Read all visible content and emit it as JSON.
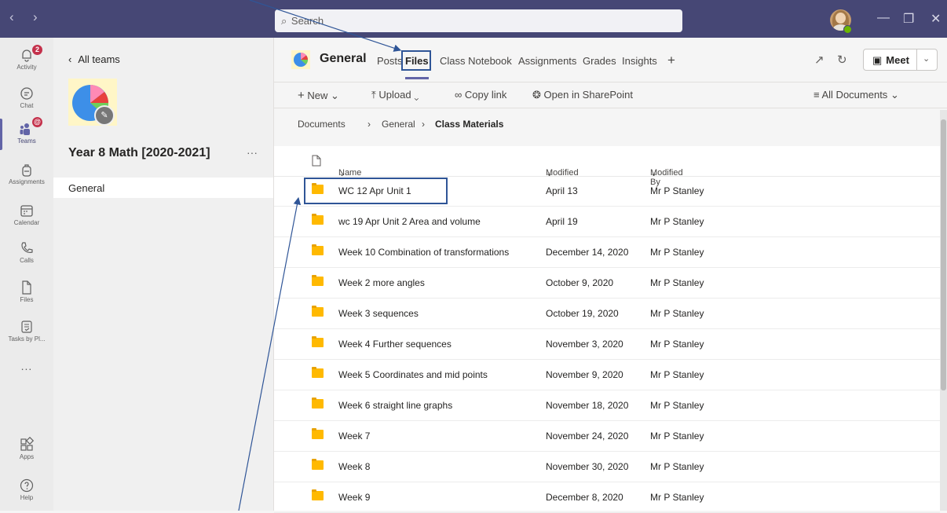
{
  "topbar": {
    "search_placeholder": "Search",
    "back_icon": "chevron-left-icon",
    "forward_icon": "chevron-right-icon",
    "minimize_icon": "minimize-icon",
    "restore_icon": "restore-icon",
    "close_icon": "close-icon"
  },
  "rail": {
    "items": [
      {
        "label": "Activity",
        "icon": "bell-icon",
        "badge": "2"
      },
      {
        "label": "Chat",
        "icon": "chat-icon"
      },
      {
        "label": "Teams",
        "icon": "teams-icon",
        "badge": "@"
      },
      {
        "label": "Assignments",
        "icon": "backpack-icon"
      },
      {
        "label": "Calendar",
        "icon": "calendar-icon"
      },
      {
        "label": "Calls",
        "icon": "phone-icon"
      },
      {
        "label": "Files",
        "icon": "file-icon"
      },
      {
        "label": "Tasks by Pl...",
        "icon": "tasks-icon"
      },
      {
        "label": "...",
        "icon": "more-icon"
      },
      {
        "label": "Apps",
        "icon": "apps-icon"
      },
      {
        "label": "Help",
        "icon": "help-icon"
      }
    ]
  },
  "teampanel": {
    "back_label": "All teams",
    "team_name": "Year 8 Math [2020-2021]",
    "more": "···",
    "channels": [
      "General"
    ]
  },
  "channel_header": {
    "name": "General",
    "tabs": [
      "Posts",
      "Files",
      "Class Notebook",
      "Assignments",
      "Grades",
      "Insights"
    ],
    "active_tab": "Files",
    "add_tab": "+",
    "meet_label": "Meet"
  },
  "toolbar": {
    "new_label": "New",
    "upload_label": "Upload",
    "copy_link_label": "Copy link",
    "open_sharepoint_label": "Open in SharePoint",
    "view_label": "All Documents"
  },
  "breadcrumb": {
    "items": [
      "Documents",
      "General",
      "Class Materials"
    ]
  },
  "table": {
    "headers": {
      "name": "Name",
      "modified": "Modified",
      "modified_by": "Modified By"
    },
    "rows": [
      {
        "name": "WC 12 Apr Unit 1",
        "modified": "April 13",
        "by": "Mr P Stanley"
      },
      {
        "name": "wc 19 Apr Unit 2 Area and volume",
        "modified": "April 19",
        "by": "Mr P Stanley"
      },
      {
        "name": "Week 10 Combination of transformations",
        "modified": "December 14, 2020",
        "by": "Mr P Stanley"
      },
      {
        "name": "Week 2 more angles",
        "modified": "October 9, 2020",
        "by": "Mr P Stanley"
      },
      {
        "name": "Week 3 sequences",
        "modified": "October 19, 2020",
        "by": "Mr P Stanley"
      },
      {
        "name": "Week 4 Further sequences",
        "modified": "November 3, 2020",
        "by": "Mr P Stanley"
      },
      {
        "name": "Week 5 Coordinates and mid points",
        "modified": "November 9, 2020",
        "by": "Mr P Stanley"
      },
      {
        "name": "Week 6 straight line graphs",
        "modified": "November 18, 2020",
        "by": "Mr P Stanley"
      },
      {
        "name": "Week 7",
        "modified": "November 24, 2020",
        "by": "Mr P Stanley"
      },
      {
        "name": "Week 8",
        "modified": "November 30, 2020",
        "by": "Mr P Stanley"
      },
      {
        "name": "Week 9",
        "modified": "December 8, 2020",
        "by": "Mr P Stanley"
      }
    ]
  },
  "colors": {
    "topbar": "#464775",
    "accent": "#6264a7",
    "annotation": "#2f5597",
    "folder": "#ffb900",
    "badge": "#c4314b"
  }
}
